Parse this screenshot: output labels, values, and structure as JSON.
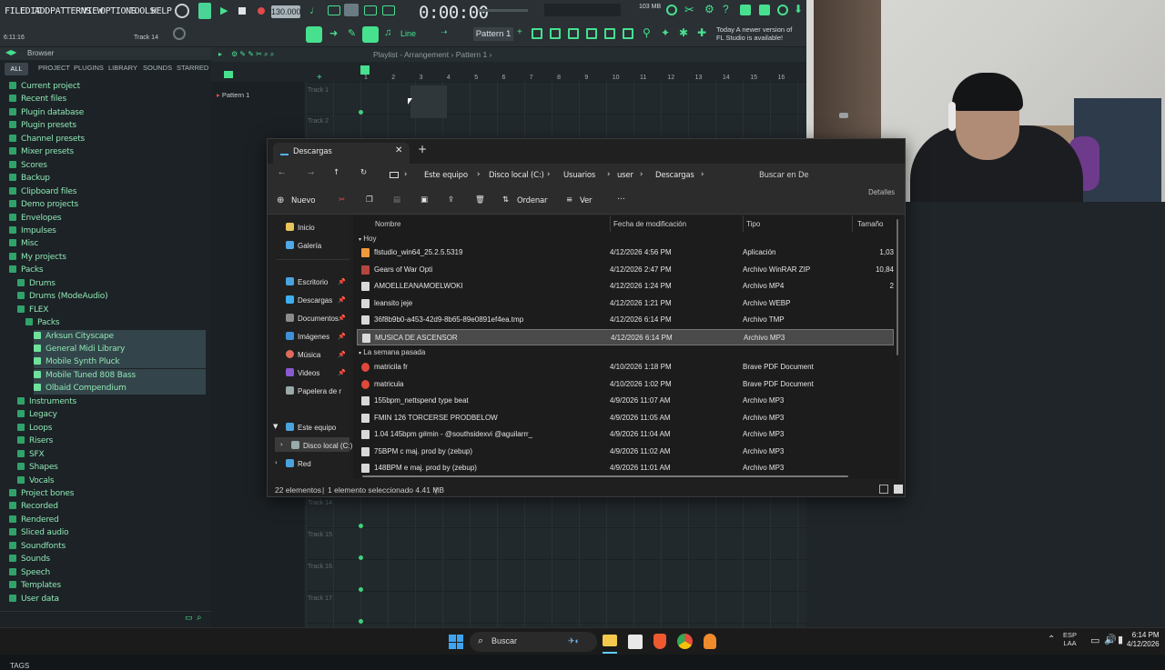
{
  "fl": {
    "menu": [
      "FILE",
      "EDIT",
      "ADD",
      "PATTERNS",
      "VIEW",
      "OPTIONS",
      "TOOLS",
      "HELP"
    ],
    "tempo": "130.000",
    "time": "0:00:00",
    "memory": "103 MB",
    "hint_time": "6:11:16",
    "track_label": "Track 14",
    "pattern": "Pattern 1",
    "snap": "Line",
    "notice_line1": "Today  A newer version of",
    "notice_line2": "FL Studio is available!",
    "playlist_title": "Playlist - Arrangement › Pattern 1 ›",
    "pattern_item": "Pattern 1",
    "ruler": [
      "1",
      "2",
      "3",
      "4",
      "5",
      "6",
      "7",
      "8",
      "9",
      "10",
      "11",
      "12",
      "13",
      "14",
      "15",
      "16"
    ],
    "tracks_top": [
      "Track 1",
      "Track 2"
    ],
    "tracks_bottom": [
      "Track 14",
      "Track 15",
      "Track 16",
      "Track 17"
    ]
  },
  "browser": {
    "title": "Browser",
    "tabs": [
      "ALL",
      "PROJECT",
      "PLUGINS",
      "LIBRARY",
      "SOUNDS",
      "STARRED"
    ],
    "items": [
      "Current project",
      "Recent files",
      "Plugin database",
      "Plugin presets",
      "Channel presets",
      "Mixer presets",
      "Scores",
      "Backup",
      "Clipboard files",
      "Demo projects",
      "Envelopes",
      "Impulses",
      "Misc",
      "My projects",
      "Packs",
      "Drums",
      "Drums (ModeAudio)",
      "FLEX",
      "Packs",
      "Arksun Cityscape",
      "General Midi Library",
      "Mobile Synth Pluck",
      "Mobile Tuned 808 Bass",
      "Olbaid Compendium",
      "Instruments",
      "Legacy",
      "Loops",
      "Risers",
      "SFX",
      "Shapes",
      "Vocals",
      "Project bones",
      "Recorded",
      "Rendered",
      "Sliced audio",
      "Soundfonts",
      "Sounds",
      "Speech",
      "Templates",
      "User data"
    ],
    "tags": "TAGS"
  },
  "explorer": {
    "tab_title": "Descargas",
    "breadcrumb": [
      "Este equipo",
      "Disco local (C:)",
      "Usuarios",
      "user",
      "Descargas"
    ],
    "search_placeholder": "Buscar en De",
    "cmd_new": "Nuevo",
    "cmd_sort": "Ordenar",
    "cmd_view": "Ver",
    "cmd_details": "Detalles",
    "columns": [
      "Nombre",
      "Fecha de modificación",
      "Tipo",
      "Tamaño"
    ],
    "nav": {
      "home": "Inicio",
      "gallery": "Galería",
      "quick": [
        "Escritorio",
        "Descargas",
        "Documentos",
        "Imágenes",
        "Música",
        "Videos",
        "Papelera de r"
      ],
      "this_pc": "Este equipo",
      "drive": "Disco local (C:)",
      "network": "Red"
    },
    "group_today": "Hoy",
    "group_week": "La semana pasada",
    "files_today": [
      {
        "name": "flstudio_win64_25.2.5.5319",
        "date": "4/12/2026 4:56 PM",
        "type": "Aplicación",
        "size": "1,03"
      },
      {
        "name": "Gears of War Opti",
        "date": "4/12/2026 2:47 PM",
        "type": "Archivo WinRAR ZIP",
        "size": "10,84"
      },
      {
        "name": "AMOELLEANAMOELWOKI",
        "date": "4/12/2026 1:24 PM",
        "type": "Archivo MP4",
        "size": "2"
      },
      {
        "name": "leansito jeje",
        "date": "4/12/2026 1:21 PM",
        "type": "Archivo WEBP",
        "size": ""
      },
      {
        "name": "36f8b9b0-a453-42d9-8b65-89e0891ef4ea.tmp",
        "date": "4/12/2026 6:14 PM",
        "type": "Archivo TMP",
        "size": ""
      },
      {
        "name": "MUSICA DE ASCENSOR",
        "date": "4/12/2026 6:14 PM",
        "type": "Archivo MP3",
        "size": ""
      }
    ],
    "files_week": [
      {
        "name": "matricila fr",
        "date": "4/10/2026 1:18 PM",
        "type": "Brave PDF Document",
        "size": ""
      },
      {
        "name": "matricula",
        "date": "4/10/2026 1:02 PM",
        "type": "Brave PDF Document",
        "size": ""
      },
      {
        "name": "155bpm_nettspend type beat",
        "date": "4/9/2026 11:07 AM",
        "type": "Archivo MP3",
        "size": ""
      },
      {
        "name": "FMIN 126 TORCERSE PRODBELOW",
        "date": "4/9/2026 11:05 AM",
        "type": "Archivo MP3",
        "size": ""
      },
      {
        "name": "1.04 145bpm g#min - @southsidexvi @aguilarrr_",
        "date": "4/9/2026 11:04 AM",
        "type": "Archivo MP3",
        "size": ""
      },
      {
        "name": "75BPM c maj. prod by (zebup)",
        "date": "4/9/2026 11:02 AM",
        "type": "Archivo MP3",
        "size": ""
      },
      {
        "name": "148BPM e maj. prod by (zebup)",
        "date": "4/9/2026 11:01 AM",
        "type": "Archivo MP3",
        "size": ""
      }
    ],
    "status_count": "22 elementos",
    "status_sel": "1 elemento seleccionado  4.41 MB"
  },
  "taskbar": {
    "search": "Buscar",
    "lang1": "ESP",
    "lang2": "LAA",
    "time": "6:14 PM",
    "date": "4/12/2026"
  }
}
